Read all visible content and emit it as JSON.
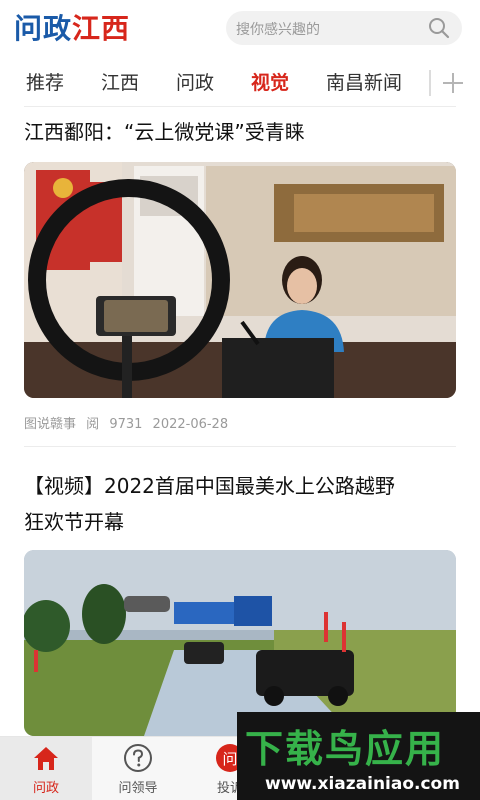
{
  "header": {
    "logo_part1": "问政",
    "logo_part2": "江西",
    "search_placeholder": "搜你感兴趣的"
  },
  "tabs": [
    {
      "label": "推荐",
      "active": false
    },
    {
      "label": "江西",
      "active": false
    },
    {
      "label": "问政",
      "active": false
    },
    {
      "label": "视觉",
      "active": true
    },
    {
      "label": "南昌新闻",
      "active": false
    }
  ],
  "articles": [
    {
      "title": "江西鄱阳：“云上微党课”受青睐",
      "source": "图说赣事",
      "views_label": "阅",
      "views": "9731",
      "date": "2022-06-28"
    },
    {
      "title_line1": "【视频】2022首届中国最美水上公路越野",
      "title_line2": "狂欢节开幕"
    }
  ],
  "bottom_nav": [
    {
      "label": "问政",
      "icon": "home-icon",
      "active": true
    },
    {
      "label": "问领导",
      "icon": "question-icon",
      "active": false
    },
    {
      "label": "投诉",
      "icon": "complaint-icon",
      "active": false
    }
  ],
  "watermark": {
    "title": "下载鸟应用",
    "url": "www.xiazainiao.com"
  },
  "colors": {
    "accent": "#d7261b",
    "brand_blue": "#1a5aa8",
    "watermark_green": "#36b24a"
  }
}
